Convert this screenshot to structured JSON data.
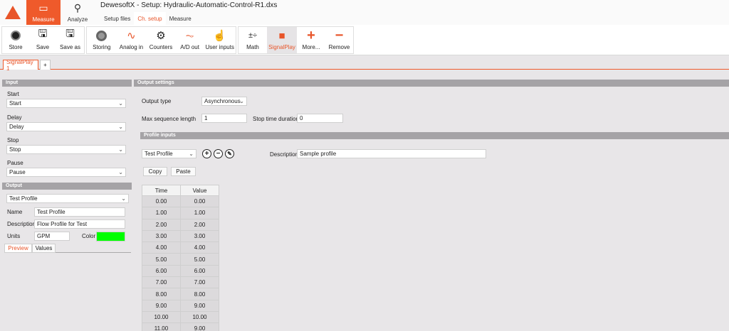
{
  "app": {
    "title": "DewesoftX - Setup: Hydraulic-Automatic-Control-R1.dxs",
    "main_tabs": [
      {
        "label": "Measure"
      },
      {
        "label": "Analyze"
      }
    ],
    "sub_tabs": [
      {
        "label": "Setup files"
      },
      {
        "label": "Ch. setup"
      },
      {
        "label": "Measure"
      }
    ]
  },
  "ribbon": {
    "store": "Store",
    "save": "Save",
    "save_as": "Save as",
    "storing": "Storing",
    "analog_in": "Analog in",
    "counters": "Counters",
    "ad_out": "A/D out",
    "user_inputs": "User inputs",
    "math": "Math",
    "signalplay": "SignalPlay",
    "more": "More...",
    "remove": "Remove"
  },
  "doc_tabs": {
    "active": "SignalPlay 1",
    "add": "+"
  },
  "input": {
    "header": "Input",
    "start_label": "Start",
    "start_value": "Start",
    "delay_label": "Delay",
    "delay_value": "Delay",
    "stop_label": "Stop",
    "stop_value": "Stop",
    "pause_label": "Pause",
    "pause_value": "Pause"
  },
  "output": {
    "header": "Output",
    "profile_value": "Test Profile",
    "name_label": "Name",
    "name_value": "Test Profile",
    "desc_label": "Description",
    "desc_value": "Flow Profile for Test",
    "units_label": "Units",
    "units_value": "GPM",
    "color_label": "Color",
    "color_hex": "#00ff00",
    "tab_preview": "Preview",
    "tab_values": "Values"
  },
  "output_settings": {
    "header": "Output settings",
    "type_label": "Output type",
    "type_value": "Asynchronous",
    "maxlen_label": "Max sequence length",
    "maxlen_value": "1",
    "stoptime_label": "Stop time duration",
    "stoptime_value": "0"
  },
  "profile_inputs": {
    "header": "Profile inputs",
    "profile_value": "Test Profile",
    "desc_label": "Description",
    "desc_value": "Sample profile",
    "copy": "Copy",
    "paste": "Paste",
    "columns": [
      "Time",
      "Value"
    ],
    "rows": [
      [
        "0.00",
        "0.00"
      ],
      [
        "1.00",
        "1.00"
      ],
      [
        "2.00",
        "2.00"
      ],
      [
        "3.00",
        "3.00"
      ],
      [
        "4.00",
        "4.00"
      ],
      [
        "5.00",
        "5.00"
      ],
      [
        "6.00",
        "6.00"
      ],
      [
        "7.00",
        "7.00"
      ],
      [
        "8.00",
        "8.00"
      ],
      [
        "9.00",
        "9.00"
      ],
      [
        "10.00",
        "10.00"
      ],
      [
        "11.00",
        "9.00"
      ]
    ]
  },
  "colors": {
    "accent": "#ef5a2b",
    "section": "#a5a3a6"
  }
}
